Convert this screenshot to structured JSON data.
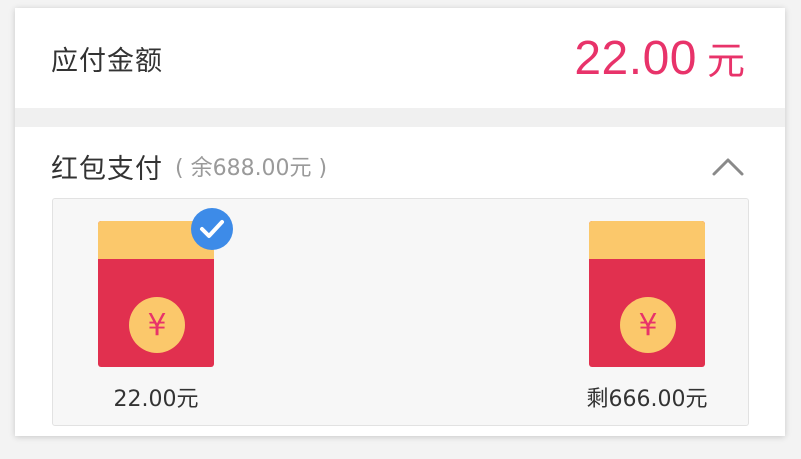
{
  "payment": {
    "label": "应付金额",
    "amount": "22.00",
    "unit": "元"
  },
  "red_packet_section": {
    "title": "红包支付",
    "remaining": "( 余688.00元 )",
    "collapse_icon": "chevron-up-icon",
    "packets": [
      {
        "label": "22.00元",
        "symbol": "¥",
        "selected": true
      },
      {
        "label": "剩666.00元",
        "symbol": "¥",
        "selected": false
      }
    ]
  },
  "colors": {
    "accent": "#e8336a",
    "envelope": "#e1304f",
    "envelope_flap": "#fbc86b",
    "check": "#3d8be8"
  }
}
